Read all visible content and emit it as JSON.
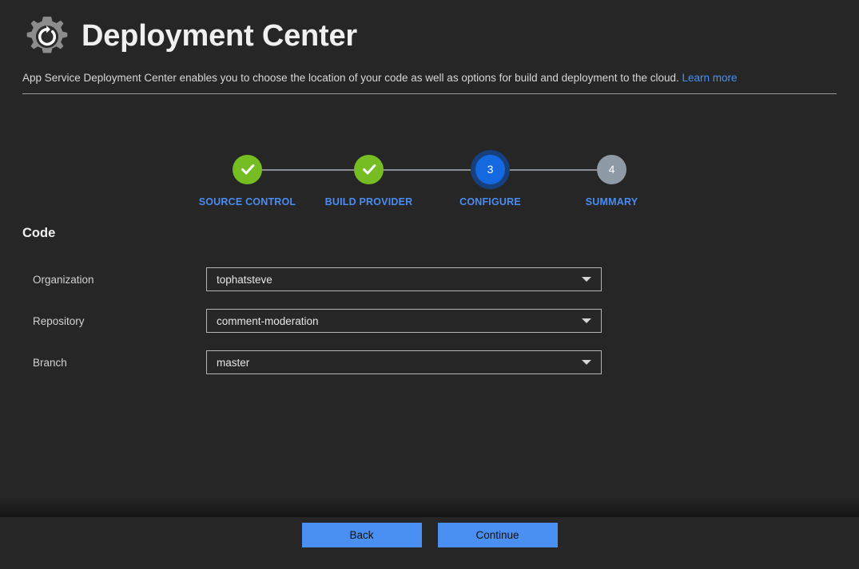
{
  "header": {
    "icon": "deployment-gear-icon",
    "title": "Deployment Center",
    "subtitle_text": "App Service Deployment Center enables you to choose the location of your code as well as options for build and deployment to the cloud.",
    "learn_more_label": "Learn more"
  },
  "stepper": {
    "steps": [
      {
        "number": "1",
        "label": "SOURCE CONTROL",
        "state": "done",
        "glyph": "check-icon"
      },
      {
        "number": "2",
        "label": "BUILD PROVIDER",
        "state": "done",
        "glyph": "check-icon"
      },
      {
        "number": "3",
        "label": "CONFIGURE",
        "state": "active",
        "glyph": "3"
      },
      {
        "number": "4",
        "label": "SUMMARY",
        "state": "pending",
        "glyph": "4"
      }
    ]
  },
  "form": {
    "section_title": "Code",
    "fields": [
      {
        "label": "Organization",
        "value": "tophatsteve",
        "icon": "chevron-down-icon"
      },
      {
        "label": "Repository",
        "value": "comment-moderation",
        "icon": "chevron-down-icon"
      },
      {
        "label": "Branch",
        "value": "master",
        "icon": "chevron-down-icon"
      }
    ]
  },
  "footer": {
    "back_label": "Back",
    "continue_label": "Continue"
  },
  "colors": {
    "background": "#262626",
    "accent_blue": "#4a90f2",
    "step_done_green": "#75bd22",
    "step_active_blue": "#1569e0",
    "step_active_ring": "#16417e",
    "step_pending_gray": "#8e9aa6",
    "text_primary": "#f0f0f0",
    "text_secondary": "#d2d2d2",
    "border": "#b4b4b4"
  }
}
